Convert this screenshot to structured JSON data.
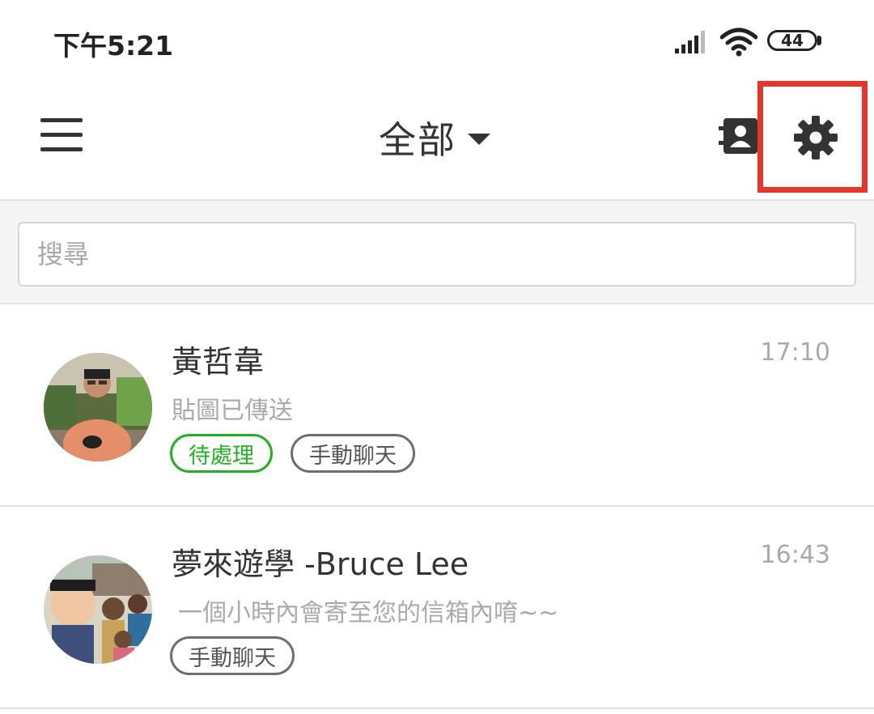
{
  "status_bar": {
    "time": "下午5:21",
    "battery": "44"
  },
  "toolbar": {
    "title": "全部"
  },
  "search": {
    "placeholder": "搜尋"
  },
  "chats": [
    {
      "name": "黃哲韋",
      "time": "17:10",
      "preview": "貼圖已傳送",
      "tags": [
        {
          "label": "待處理",
          "color": "#22b022"
        },
        {
          "label": "手動聊天",
          "color": "#6b6e7a"
        }
      ]
    },
    {
      "name": "夢來遊學 -Bruce Lee",
      "time": "16:43",
      "preview": "一個小時內會寄至您的信箱內唷~~",
      "tags": [
        {
          "label": "手動聊天",
          "color": "#6b6e7a"
        }
      ]
    }
  ],
  "colors": {
    "highlight_box": "#e8352c",
    "tag_green": "#22b022",
    "tag_gray": "#6b6e7a"
  }
}
